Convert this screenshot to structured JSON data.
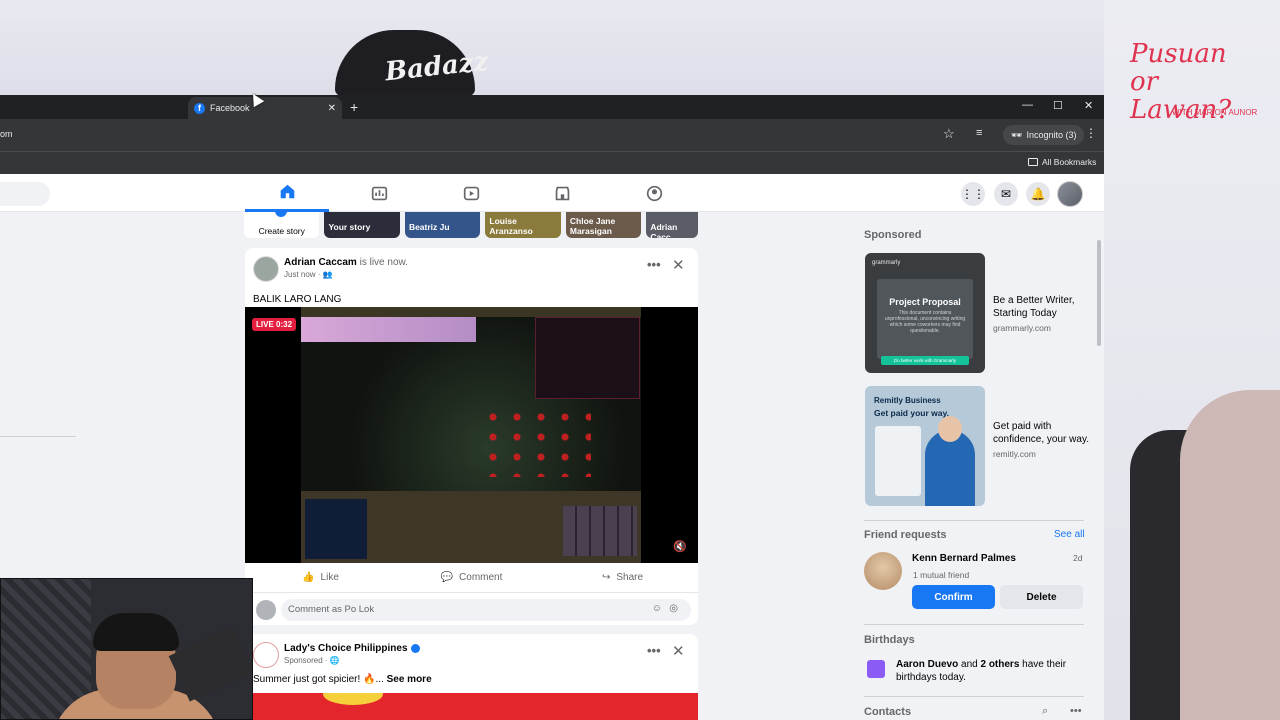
{
  "background": {
    "cap_text": "Badazz",
    "brand_logo": "Pusuan or Lawan?",
    "brand_sub": "WITH MARION AUNOR"
  },
  "browser": {
    "tab_title": "Facebook",
    "tab_favicon": "f",
    "url_fragment": "om",
    "incognito_label": "Incognito (3)",
    "all_bookmarks": "All Bookmarks",
    "icons": [
      "new-tab-icon",
      "minimize-icon",
      "maximize-icon",
      "close-icon",
      "star-icon",
      "tab-search-icon",
      "incognito-icon",
      "kebab-menu-icon",
      "folder-icon"
    ]
  },
  "header": {
    "nav": [
      "home-icon",
      "dashboard-icon",
      "video-icon",
      "marketplace-icon",
      "groups-icon"
    ],
    "right_icons": [
      "apps-grid-icon",
      "messenger-icon",
      "bell-icon",
      "avatar"
    ]
  },
  "stories": [
    {
      "label": "Create story"
    },
    {
      "label": "Your story"
    },
    {
      "label": "Beatriz Ju"
    },
    {
      "label": "Louise Aranzanso"
    },
    {
      "label": "Chloe Jane Marasigan"
    },
    {
      "label": "Adrian Cacc"
    }
  ],
  "post1": {
    "author": "Adrian Caccam",
    "status": "is live now.",
    "meta": "Just now · ",
    "text": "BALIK LARO LANG",
    "live_badge": "LIVE 0:32",
    "actions": {
      "like": "Like",
      "comment": "Comment",
      "share": "Share"
    },
    "comment_placeholder": "Comment as Po Lok"
  },
  "post2": {
    "author": "Lady's Choice Philippines",
    "meta": "Sponsored · ",
    "text": "Summer just got spicier! 🔥... ",
    "see_more": "See more"
  },
  "right": {
    "sponsored_title": "Sponsored",
    "ads": [
      {
        "title": "Be a Better Writer, Starting Today",
        "domain": "grammarly.com",
        "img_title": "Project Proposal",
        "img_logo": "grammarly",
        "img_small": "This document contains unprofessional, unconvincing writing which some coworkers may find questionable.",
        "img_button": "Do better work with Grammarly"
      },
      {
        "title": "Get paid with confidence, your way.",
        "domain": "remitly.com",
        "img_header": "Remitly Business",
        "img_sub": "Get paid your way."
      }
    ],
    "friend_requests_title": "Friend requests",
    "see_all": "See all",
    "friend": {
      "name": "Kenn Bernard Palmes",
      "time": "2d",
      "mutual": "1 mutual friend",
      "confirm": "Confirm",
      "delete": "Delete"
    },
    "birthdays_title": "Birthdays",
    "birthday_name": "Aaron Duevo",
    "birthday_and": " and ",
    "birthday_others": "2 others",
    "birthday_rest": " have their birthdays today.",
    "contacts_title": "Contacts"
  },
  "colors": {
    "fb_blue": "#1877f2",
    "live_red": "#e41e3f",
    "chrome_dark": "#202124"
  }
}
